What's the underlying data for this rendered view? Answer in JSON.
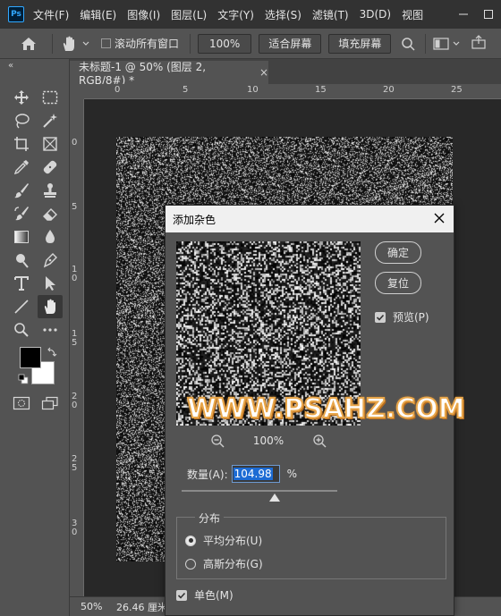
{
  "menubar": {
    "logo": "Ps",
    "items": [
      "文件(F)",
      "编辑(E)",
      "图像(I)",
      "图层(L)",
      "文字(Y)",
      "选择(S)",
      "滤镜(T)",
      "3D(D)",
      "视图"
    ]
  },
  "options": {
    "scroll_all_label": "滚动所有窗口",
    "zoom_value": "100%",
    "fit_screen_label": "适合屏幕",
    "fill_screen_label": "填充屏幕"
  },
  "document": {
    "tab_title": "未标题-1 @ 50% (图层 2, RGB/8#) *",
    "tab_close": "×"
  },
  "rulers": {
    "top": [
      "0",
      "5",
      "10",
      "15",
      "20",
      "25"
    ],
    "left": [
      "0",
      "5",
      "1\n0",
      "1\n5",
      "2\n0",
      "2\n5",
      "3\n0"
    ]
  },
  "status": {
    "zoom": "50%",
    "info": "26.46 厘米"
  },
  "dialog": {
    "title": "添加杂色",
    "ok_label": "确定",
    "reset_label": "复位",
    "preview_label": "预览(P)",
    "preview_checked": true,
    "preview_zoom": "100%",
    "amount_label": "数量(A):",
    "amount_value": "104.98",
    "amount_unit": "%",
    "amount_slider_fraction": 0.6,
    "distribution_label": "分布",
    "uniform_label": "平均分布(U)",
    "gaussian_label": "高斯分布(G)",
    "selected_distribution": "uniform",
    "mono_label": "单色(M)",
    "mono_checked": true
  },
  "watermark": "WWW.PSAHZ.COM",
  "colors": {
    "accent": "#31a8ff",
    "foreground": "#000000",
    "background": "#ffffff",
    "watermark_stroke": "#e8a64a"
  }
}
